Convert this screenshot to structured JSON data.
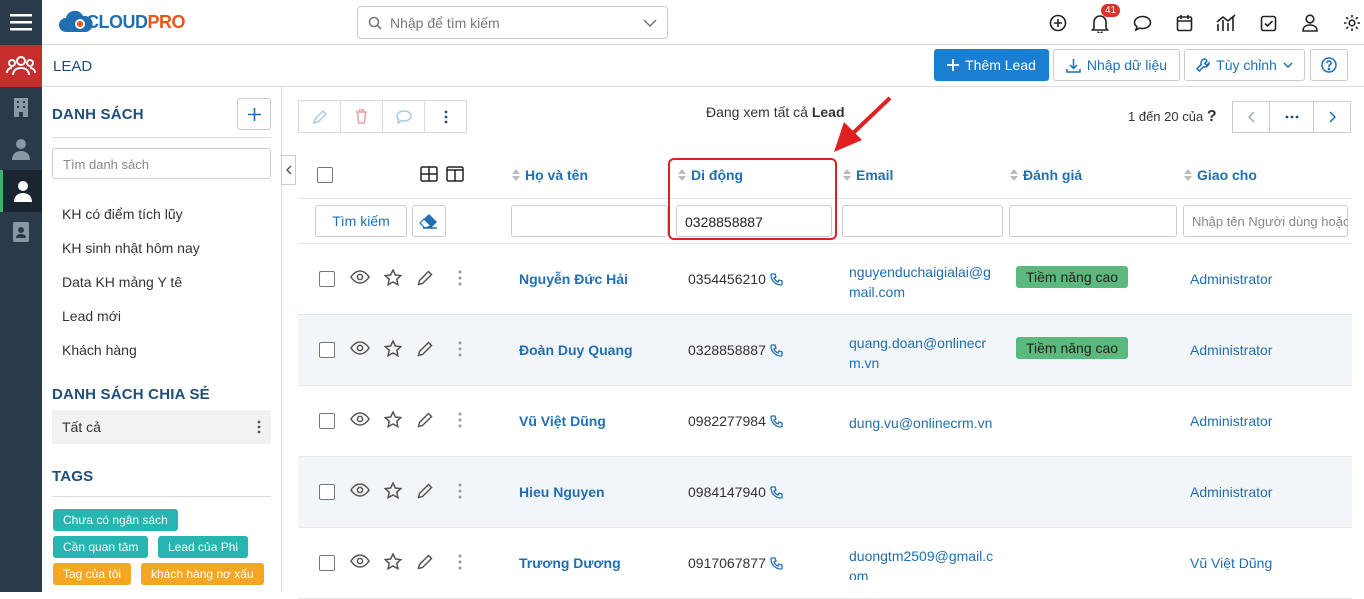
{
  "app": {
    "logo_text_a": "CLOUD",
    "logo_text_b": "PRO",
    "brand_color": "#1f6fb2",
    "accent_color": "#e8561a"
  },
  "search": {
    "placeholder": "Nhập để tìm kiếm"
  },
  "notifications": {
    "count": "41"
  },
  "page": {
    "title": "LEAD"
  },
  "actions": {
    "add_lead": "Thêm Lead",
    "import": "Nhập dữ liệu",
    "customize": "Tùy chỉnh"
  },
  "sidebar": {
    "list_title": "DANH SÁCH",
    "search_placeholder": "Tìm danh sách",
    "items": [
      {
        "label": "KH có điểm tích lũy"
      },
      {
        "label": "KH sinh nhật hôm nay"
      },
      {
        "label": "Data KH mảng Y tê"
      },
      {
        "label": "Lead mới"
      },
      {
        "label": "Khách hàng"
      }
    ],
    "shared_title": "DANH SÁCH CHIA SẺ",
    "shared_item": "Tất cả",
    "tags_title": "TAGS",
    "tags": [
      {
        "label": "Chưa có ngân sách",
        "color": "#26b5b0"
      },
      {
        "label": "Cần quan tâm",
        "color": "#26b5b0"
      },
      {
        "label": "Lead của Phi",
        "color": "#26b5b0"
      },
      {
        "label": "Tag của tôi",
        "color": "#f5a623"
      },
      {
        "label": "khách hàng nợ xấu",
        "color": "#f5a623"
      }
    ]
  },
  "listview": {
    "viewing_prefix": "Đang xem tất cả ",
    "viewing_module": "Lead",
    "pager_text": "1 đến 20 của",
    "pager_unknown": "?",
    "search_button": "Tìm kiếm",
    "columns": {
      "name": "Họ và tên",
      "mobile": "Di động",
      "email": "Email",
      "rating": "Đánh giá",
      "assigned": "Giao cho"
    },
    "filters": {
      "mobile_value": "0328858887",
      "assigned_placeholder": "Nhập tên Người dùng hoặc Nhóm"
    },
    "rows": [
      {
        "name": "Nguyễn Đức Hải",
        "mobile": "0354456210",
        "email_1": "nguyenduchaigialai@g",
        "email_2": "mail.com",
        "rating": "Tiềm năng cao",
        "assigned": "Administrator"
      },
      {
        "name": "Đoàn Duy Quang",
        "mobile": "0328858887",
        "email_1": "quang.doan@onlinecr",
        "email_2": "m.vn",
        "rating": "Tiềm năng cao",
        "assigned": "Administrator"
      },
      {
        "name": "Vũ Việt Dũng",
        "mobile": "0982277984",
        "email_1": "dung.vu@onlinecrm.vn",
        "email_2": "",
        "rating": "",
        "assigned": "Administrator"
      },
      {
        "name": "Hieu Nguyen",
        "mobile": "0984147940",
        "email_1": "",
        "email_2": "",
        "rating": "",
        "assigned": "Administrator"
      },
      {
        "name": "Trương Dương",
        "mobile": "0917067877",
        "email_1": "duongtm2509@gmail.c",
        "email_2": "om",
        "rating": "",
        "assigned": "Vũ Việt Dũng"
      }
    ]
  }
}
